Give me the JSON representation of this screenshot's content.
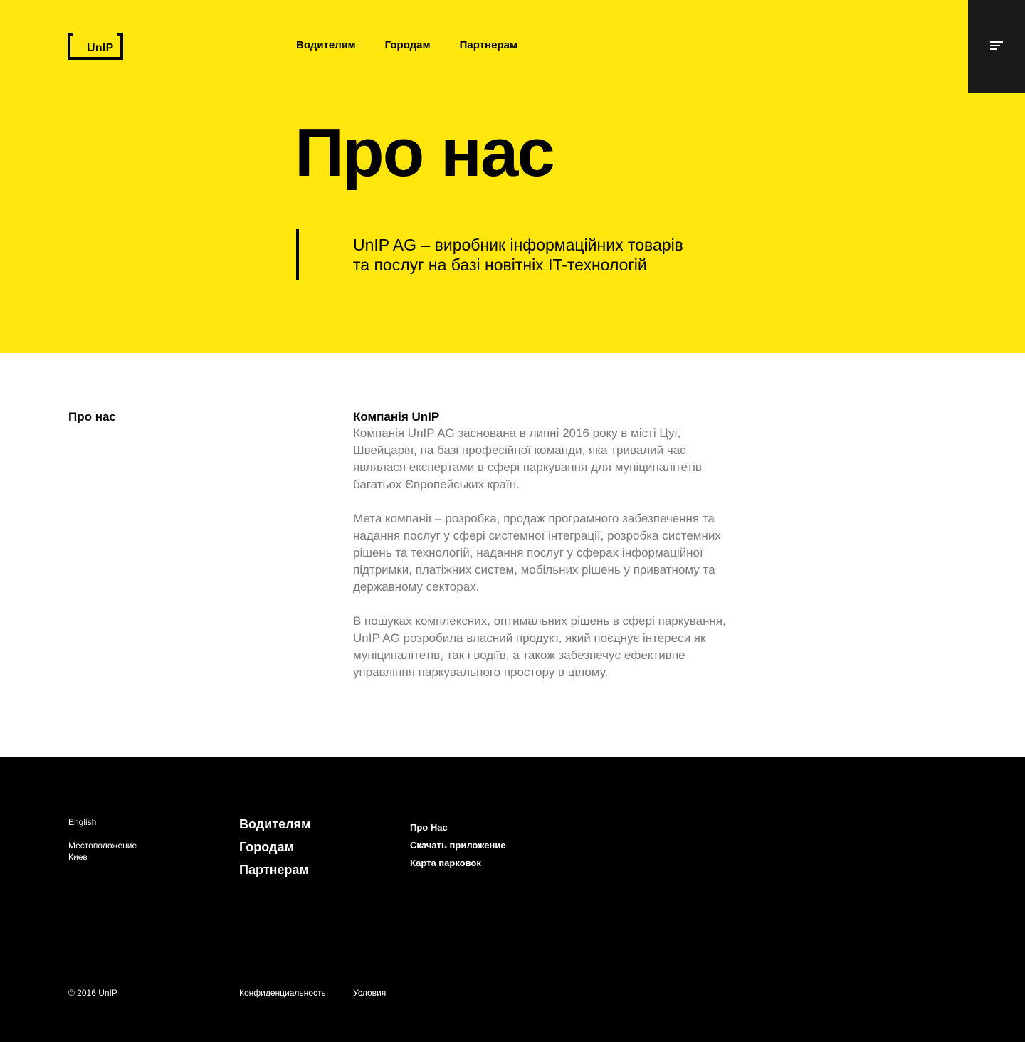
{
  "header": {
    "logo_text": "UnIP",
    "nav": [
      "Водителям",
      "Городам",
      "Партнерам"
    ],
    "menu_icon": "hamburger-menu-icon"
  },
  "hero": {
    "title": "Про нас",
    "quote_line1": "UnIP AG – виробник інформаційних товарів",
    "quote_line2": "та послуг на базі новітніх IT-технологій",
    "background_color": "#FFE70E"
  },
  "about": {
    "section_label": "Про нас",
    "heading": "Компанія UnIP",
    "paragraphs": [
      "Компанія UnIP AG заснована в липні 2016 року в місті Цуг, Швейцарія, на базі професійної команди, яка тривалий час являлася експертами в сфері паркування для муніципалітетів багатьох Європейських країн.",
      "Мета компанії – розробка, продаж програмного забезпечення та надання послуг у сфері системної інтеграції, розробка системних рішень та технологій, надання послуг у сферах інформаційної підтримки, платіжних систем, мобільних рішень у приватному та державному секторах.",
      "В пошуках комплексних, оптимальних рішень в сфері паркування, UnIP AG розробила власний продукт, який поєднує інтереси як муніципалітетів, так і водіїв, а також забезпечує ефективне управління паркувального простору в цілому."
    ]
  },
  "footer": {
    "language": "English",
    "location_label": "Местоположение",
    "location_value": "Киев",
    "main_links": [
      "Водителям",
      "Городам",
      "Партнерам"
    ],
    "secondary_links": [
      "Про Нас",
      "Скачать приложение",
      "Карта парковок"
    ],
    "copyright": "© 2016 UnIP",
    "privacy": "Конфиденциальность",
    "terms": "Условия"
  }
}
